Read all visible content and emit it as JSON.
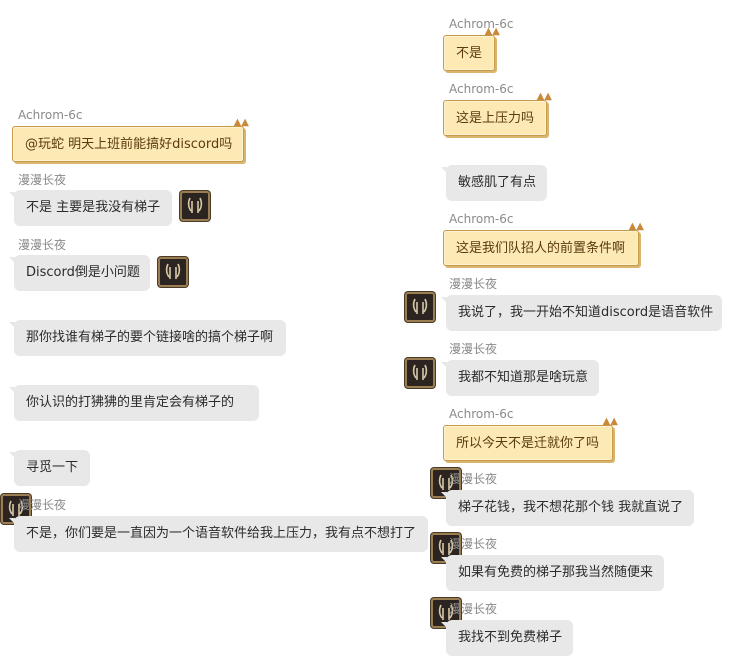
{
  "left_messages": [
    {
      "sender": "Achrom-6c",
      "text": "@玩蛇 明天上班前能搞好discord吗",
      "style": "gold"
    },
    {
      "sender": "漫漫长夜",
      "text": "不是 主要是我没有梯子",
      "style": "gray"
    },
    {
      "sender": "漫漫长夜",
      "text": "Discord倒是小问题",
      "style": "gray"
    },
    {
      "sender": "",
      "text": "那你找谁有梯子的要个链接啥的搞个梯子啊",
      "style": "gray"
    },
    {
      "sender": "",
      "text": "你认识的打狒狒的里肯定会有梯子的",
      "style": "gray"
    },
    {
      "sender": "",
      "text": "寻觅一下",
      "style": "gray"
    },
    {
      "sender": "漫漫长夜",
      "text": "不是，你们要是一直因为一个语音软件给我上压力，我有点不想打了",
      "style": "gray"
    }
  ],
  "right_messages": [
    {
      "sender": "Achrom-6c",
      "text": "不是",
      "style": "gold"
    },
    {
      "sender": "Achrom-6c",
      "text": "这是上压力吗",
      "style": "gold"
    },
    {
      "sender": "",
      "text": "敏感肌了有点",
      "style": "gray"
    },
    {
      "sender": "Achrom-6c",
      "text": "这是我们队招人的前置条件啊",
      "style": "gold"
    },
    {
      "sender": "漫漫长夜",
      "text": "我说了，我一开始不知道discord是语音软件",
      "style": "gray"
    },
    {
      "sender": "漫漫长夜",
      "text": "我都不知道那是啥玩意",
      "style": "gray"
    },
    {
      "sender": "Achrom-6c",
      "text": "所以今天不是迁就你了吗",
      "style": "gold"
    },
    {
      "sender": "漫漫长夜",
      "text": "梯子花钱，我不想花那个钱 我就直说了",
      "style": "gray"
    },
    {
      "sender": "漫漫长夜",
      "text": "如果有免费的梯子那我当然随便来",
      "style": "gray"
    },
    {
      "sender": "漫漫长夜",
      "text": "我找不到免费梯子",
      "style": "gray"
    }
  ],
  "colors": {
    "gray_bubble": "#e8e8e8",
    "gold_bubble": "#fde9b3",
    "gold_border": "#c89a4c",
    "sender_text": "#8a8a8a"
  },
  "icons": {
    "avatar": "rune-avatar-icon",
    "bubble_decor": "cat-ear-icon"
  }
}
